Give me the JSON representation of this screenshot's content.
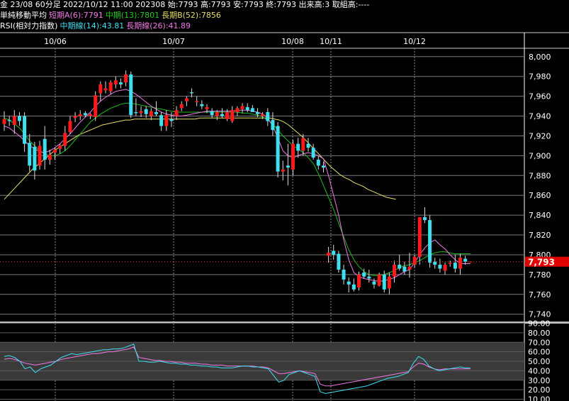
{
  "header": {
    "line1": "金 23/08 60分足 2022/10/12 11:00 202308 始:7793 高:7793 安:7793 終:7793 出来高:3 取組高:----",
    "ma_title": "単純移動平均",
    "ma_short": "短期A(6):7791",
    "ma_mid": "中期(13):7801",
    "ma_long": "長期B(52):7856",
    "rsi_title": "RSI(相対力指数)",
    "rsi_mid": "中期線(14):43.81",
    "rsi_long": "長期線(26):41.89"
  },
  "colors": {
    "background": "#000000",
    "up_candle": "#ff1a1a",
    "down_candle": "#3ee0f0",
    "ma_short": "#f27ae6",
    "ma_mid": "#22bb22",
    "ma_long": "#e6df6a",
    "rsi_mid": "#3ee0f0",
    "rsi_long": "#f27ae6",
    "price_tag": "#e00000"
  },
  "chart_data": [
    {
      "type": "candlestick",
      "x_labels": [
        "10/06",
        "10/07",
        "10/08",
        "10/11",
        "10/12"
      ],
      "ylim": [
        7734,
        8010
      ],
      "y_ticks": [
        7740,
        7760,
        7780,
        7800,
        7820,
        7840,
        7860,
        7880,
        7900,
        7920,
        7940,
        7960,
        7980,
        8000
      ],
      "y_tick_labels": [
        "7,740",
        "7,760",
        "7,780",
        "7,800",
        "7,820",
        "7,840",
        "7,860",
        "7,880",
        "7,900",
        "7,920",
        "7,940",
        "7,960",
        "7,980",
        "8,000"
      ],
      "last_price": 7793,
      "last_price_label": "7,793",
      "grid": true,
      "candles": [
        {
          "o": 7932,
          "h": 7945,
          "l": 7925,
          "c": 7937
        },
        {
          "o": 7936,
          "h": 7940,
          "l": 7930,
          "c": 7935
        },
        {
          "o": 7931,
          "h": 7946,
          "l": 7922,
          "c": 7940
        },
        {
          "o": 7940,
          "h": 7944,
          "l": 7930,
          "c": 7935
        },
        {
          "o": 7940,
          "h": 7944,
          "l": 7904,
          "c": 7912
        },
        {
          "o": 7913,
          "h": 7922,
          "l": 7884,
          "c": 7890
        },
        {
          "o": 7909,
          "h": 7914,
          "l": 7876,
          "c": 7885
        },
        {
          "o": 7890,
          "h": 7915,
          "l": 7886,
          "c": 7910
        },
        {
          "o": 7917,
          "h": 7930,
          "l": 7886,
          "c": 7896
        },
        {
          "o": 7896,
          "h": 7906,
          "l": 7891,
          "c": 7901
        },
        {
          "o": 7903,
          "h": 7908,
          "l": 7896,
          "c": 7906
        },
        {
          "o": 7907,
          "h": 7912,
          "l": 7902,
          "c": 7910
        },
        {
          "o": 7910,
          "h": 7930,
          "l": 7905,
          "c": 7923
        },
        {
          "o": 7924,
          "h": 7940,
          "l": 7922,
          "c": 7935
        },
        {
          "o": 7938,
          "h": 7944,
          "l": 7934,
          "c": 7940
        },
        {
          "o": 7940,
          "h": 7946,
          "l": 7936,
          "c": 7942
        },
        {
          "o": 7943,
          "h": 7945,
          "l": 7939,
          "c": 7941
        },
        {
          "o": 7940,
          "h": 7943,
          "l": 7937,
          "c": 7942
        },
        {
          "o": 7939,
          "h": 7965,
          "l": 7935,
          "c": 7961
        },
        {
          "o": 7963,
          "h": 7975,
          "l": 7955,
          "c": 7972
        },
        {
          "o": 7966,
          "h": 7975,
          "l": 7963,
          "c": 7968
        },
        {
          "o": 7965,
          "h": 7976,
          "l": 7962,
          "c": 7974
        },
        {
          "o": 7972,
          "h": 7980,
          "l": 7968,
          "c": 7976
        },
        {
          "o": 7974,
          "h": 7978,
          "l": 7968,
          "c": 7972
        },
        {
          "o": 7974,
          "h": 7986,
          "l": 7970,
          "c": 7982
        },
        {
          "o": 7982,
          "h": 7985,
          "l": 7938,
          "c": 7941
        },
        {
          "o": 7944,
          "h": 7958,
          "l": 7940,
          "c": 7943
        },
        {
          "o": 7943,
          "h": 7950,
          "l": 7939,
          "c": 7945
        },
        {
          "o": 7947,
          "h": 7950,
          "l": 7938,
          "c": 7942
        },
        {
          "o": 7940,
          "h": 7948,
          "l": 7936,
          "c": 7945
        },
        {
          "o": 7944,
          "h": 7955,
          "l": 7940,
          "c": 7942
        },
        {
          "o": 7941,
          "h": 7944,
          "l": 7925,
          "c": 7930
        },
        {
          "o": 7930,
          "h": 7946,
          "l": 7925,
          "c": 7941
        },
        {
          "o": 7937,
          "h": 7944,
          "l": 7929,
          "c": 7935
        },
        {
          "o": 7940,
          "h": 7950,
          "l": 7936,
          "c": 7946
        },
        {
          "o": 7948,
          "h": 7955,
          "l": 7945,
          "c": 7952
        },
        {
          "o": 7955,
          "h": 7960,
          "l": 7950,
          "c": 7958
        },
        {
          "o": 7964,
          "h": 7968,
          "l": 7959,
          "c": 7963
        },
        {
          "o": 7954,
          "h": 7960,
          "l": 7950,
          "c": 7955
        },
        {
          "o": 7952,
          "h": 7956,
          "l": 7947,
          "c": 7950
        },
        {
          "o": 7947,
          "h": 7952,
          "l": 7943,
          "c": 7949
        },
        {
          "o": 7945,
          "h": 7948,
          "l": 7938,
          "c": 7941
        },
        {
          "o": 7940,
          "h": 7946,
          "l": 7936,
          "c": 7944
        },
        {
          "o": 7942,
          "h": 7948,
          "l": 7938,
          "c": 7940
        },
        {
          "o": 7937,
          "h": 7947,
          "l": 7935,
          "c": 7944
        },
        {
          "o": 7935,
          "h": 7950,
          "l": 7933,
          "c": 7946
        },
        {
          "o": 7944,
          "h": 7950,
          "l": 7940,
          "c": 7948
        },
        {
          "o": 7947,
          "h": 7953,
          "l": 7943,
          "c": 7950
        },
        {
          "o": 7949,
          "h": 7953,
          "l": 7944,
          "c": 7946
        },
        {
          "o": 7948,
          "h": 7951,
          "l": 7945,
          "c": 7944
        },
        {
          "o": 7944,
          "h": 7948,
          "l": 7939,
          "c": 7942
        },
        {
          "o": 7940,
          "h": 7944,
          "l": 7937,
          "c": 7942
        },
        {
          "o": 7944,
          "h": 7948,
          "l": 7930,
          "c": 7935
        },
        {
          "o": 7936,
          "h": 7944,
          "l": 7920,
          "c": 7926
        },
        {
          "o": 7930,
          "h": 7934,
          "l": 7878,
          "c": 7884
        },
        {
          "o": 7884,
          "h": 7895,
          "l": 7875,
          "c": 7886
        },
        {
          "o": 7890,
          "h": 7912,
          "l": 7870,
          "c": 7888
        },
        {
          "o": 7886,
          "h": 7916,
          "l": 7880,
          "c": 7912
        },
        {
          "o": 7912,
          "h": 7918,
          "l": 7898,
          "c": 7905
        },
        {
          "o": 7905,
          "h": 7922,
          "l": 7900,
          "c": 7918
        },
        {
          "o": 7912,
          "h": 7918,
          "l": 7904,
          "c": 7908
        },
        {
          "o": 7908,
          "h": 7912,
          "l": 7896,
          "c": 7898
        },
        {
          "o": 7896,
          "h": 7900,
          "l": 7886,
          "c": 7890
        },
        {
          "o": 7890,
          "h": 7894,
          "l": 7883,
          "c": 7888
        },
        {
          "o": 7799,
          "h": 7808,
          "l": 7792,
          "c": 7802
        },
        {
          "o": 7804,
          "h": 7810,
          "l": 7795,
          "c": 7800
        },
        {
          "o": 7801,
          "h": 7804,
          "l": 7782,
          "c": 7785
        },
        {
          "o": 7785,
          "h": 7790,
          "l": 7770,
          "c": 7775
        },
        {
          "o": 7773,
          "h": 7777,
          "l": 7762,
          "c": 7770
        },
        {
          "o": 7770,
          "h": 7776,
          "l": 7763,
          "c": 7765
        },
        {
          "o": 7767,
          "h": 7783,
          "l": 7764,
          "c": 7780
        },
        {
          "o": 7782,
          "h": 7786,
          "l": 7776,
          "c": 7778
        },
        {
          "o": 7778,
          "h": 7785,
          "l": 7772,
          "c": 7776
        },
        {
          "o": 7773,
          "h": 7776,
          "l": 7766,
          "c": 7770
        },
        {
          "o": 7769,
          "h": 7782,
          "l": 7768,
          "c": 7780
        },
        {
          "o": 7780,
          "h": 7784,
          "l": 7762,
          "c": 7765
        },
        {
          "o": 7766,
          "h": 7782,
          "l": 7760,
          "c": 7778
        },
        {
          "o": 7778,
          "h": 7794,
          "l": 7772,
          "c": 7790
        },
        {
          "o": 7790,
          "h": 7800,
          "l": 7784,
          "c": 7786
        },
        {
          "o": 7788,
          "h": 7793,
          "l": 7780,
          "c": 7783
        },
        {
          "o": 7785,
          "h": 7802,
          "l": 7777,
          "c": 7788
        },
        {
          "o": 7790,
          "h": 7800,
          "l": 7787,
          "c": 7798
        },
        {
          "o": 7798,
          "h": 7838,
          "l": 7790,
          "c": 7838
        },
        {
          "o": 7838,
          "h": 7848,
          "l": 7832,
          "c": 7835
        },
        {
          "o": 7835,
          "h": 7840,
          "l": 7787,
          "c": 7792
        },
        {
          "o": 7793,
          "h": 7797,
          "l": 7786,
          "c": 7790
        },
        {
          "o": 7790,
          "h": 7796,
          "l": 7782,
          "c": 7786
        },
        {
          "o": 7784,
          "h": 7792,
          "l": 7780,
          "c": 7790
        },
        {
          "o": 7791,
          "h": 7794,
          "l": 7788,
          "c": 7792
        },
        {
          "o": 7792,
          "h": 7800,
          "l": 7782,
          "c": 7786
        },
        {
          "o": 7786,
          "h": 7801,
          "l": 7780,
          "c": 7797
        },
        {
          "o": 7796,
          "h": 7799,
          "l": 7790,
          "c": 7793
        },
        {
          "o": 7793,
          "h": 7793,
          "l": 7793,
          "c": 7793
        }
      ],
      "ma_short": [
        7930,
        7928,
        7924,
        7920,
        7915,
        7910,
        7907,
        7904,
        7903,
        7905,
        7908,
        7912,
        7917,
        7922,
        7928,
        7934,
        7939,
        7944,
        7950,
        7955,
        7959,
        7962,
        7965,
        7966,
        7967,
        7965,
        7962,
        7958,
        7954,
        7950,
        7947,
        7944,
        7942,
        7941,
        7940,
        7940,
        7941,
        7942,
        7943,
        7944,
        7945,
        7945,
        7945,
        7945,
        7945,
        7945,
        7946,
        7946,
        7946,
        7945,
        7944,
        7942,
        7938,
        7930,
        7918,
        7905,
        7900,
        7898,
        7900,
        7902,
        7903,
        7902,
        7900,
        7897,
        7880,
        7860,
        7840,
        7815,
        7795,
        7782,
        7778,
        7776,
        7775,
        7774,
        7773,
        7774,
        7775,
        7777,
        7780,
        7783,
        7785,
        7792,
        7800,
        7807,
        7812,
        7815,
        7810,
        7806,
        7800,
        7795,
        7791,
        7791,
        7791
      ],
      "ma_mid": [
        7938,
        7936,
        7932,
        7928,
        7922,
        7915,
        7910,
        7905,
        7902,
        7900,
        7900,
        7902,
        7905,
        7910,
        7916,
        7922,
        7928,
        7934,
        7938,
        7942,
        7945,
        7948,
        7950,
        7952,
        7953,
        7953,
        7952,
        7951,
        7950,
        7949,
        7948,
        7947,
        7946,
        7945,
        7944,
        7944,
        7944,
        7944,
        7944,
        7944,
        7944,
        7944,
        7944,
        7944,
        7944,
        7944,
        7944,
        7943,
        7943,
        7942,
        7941,
        7939,
        7936,
        7932,
        7926,
        7920,
        7915,
        7910,
        7907,
        7903,
        7898,
        7892,
        7882,
        7870,
        7858,
        7846,
        7832,
        7818,
        7805,
        7795,
        7788,
        7783,
        7780,
        7779,
        7779,
        7780,
        7782,
        7784,
        7787,
        7789,
        7790,
        7792,
        7794,
        7797,
        7800,
        7802,
        7803,
        7803,
        7802,
        7801,
        7801,
        7801,
        7801
      ],
      "ma_long": [
        7856,
        7861,
        7866,
        7871,
        7876,
        7881,
        7886,
        7890,
        7894,
        7898,
        7902,
        7906,
        7909,
        7912,
        7915,
        7918,
        7921,
        7923,
        7925,
        7927,
        7929,
        7931,
        7932,
        7933,
        7934,
        7935,
        7936,
        7936,
        7937,
        7937,
        7937,
        7937,
        7937,
        7937,
        7937,
        7937,
        7937,
        7937,
        7937,
        7937,
        7937,
        7937,
        7938,
        7938,
        7938,
        7938,
        7938,
        7938,
        7938,
        7938,
        7938,
        7938,
        7938,
        7938,
        7938,
        7938,
        7938,
        7938,
        7937,
        7936,
        7934,
        7931,
        7927,
        7923,
        7919,
        7914,
        7909,
        7904,
        7899,
        7894,
        7889,
        7885,
        7881,
        7878,
        7876,
        7873,
        7871,
        7869,
        7866,
        7864,
        7862,
        7860,
        7858,
        7857,
        7856
      ]
    },
    {
      "type": "line",
      "ylim": [
        10,
        90
      ],
      "y_ticks": [
        10,
        20,
        30,
        40,
        50,
        60,
        70,
        80,
        90
      ],
      "y_tick_labels": [
        "10.00",
        "20.00",
        "30.00",
        "40.00",
        "50.00",
        "60.00",
        "70.00",
        "80.00",
        "90.00"
      ],
      "bands": [
        [
          30,
          70
        ]
      ],
      "series": [
        {
          "name": "中期線(14)",
          "values": [
            55,
            56,
            54,
            50,
            42,
            44,
            38,
            42,
            44,
            46,
            50,
            54,
            56,
            58,
            57,
            58,
            59,
            60,
            61,
            62,
            62,
            63,
            63,
            64,
            66,
            68,
            50,
            50,
            49,
            49,
            50,
            49,
            48,
            48,
            47,
            47,
            46,
            46,
            45,
            45,
            44,
            44,
            43,
            43,
            43,
            44,
            45,
            45,
            44,
            44,
            43,
            42,
            35,
            28,
            30,
            36,
            38,
            40,
            38,
            36,
            34,
            18,
            16,
            17,
            18,
            19,
            20,
            21,
            22,
            23,
            24,
            26,
            28,
            30,
            32,
            33,
            34,
            36,
            38,
            48,
            55,
            52,
            45,
            42,
            40,
            41,
            42,
            43,
            44,
            43,
            43
          ]
        },
        {
          "name": "長期線(26)",
          "values": [
            52,
            53,
            52,
            50,
            48,
            47,
            46,
            47,
            48,
            49,
            50,
            52,
            53,
            54,
            55,
            56,
            57,
            58,
            58,
            59,
            60,
            60,
            61,
            62,
            63,
            65,
            54,
            53,
            52,
            51,
            51,
            50,
            50,
            49,
            49,
            48,
            48,
            48,
            47,
            47,
            46,
            46,
            46,
            45,
            45,
            45,
            45,
            45,
            45,
            44,
            44,
            43,
            40,
            37,
            37,
            38,
            39,
            40,
            39,
            38,
            37,
            26,
            24,
            24,
            25,
            26,
            27,
            28,
            29,
            30,
            31,
            32,
            33,
            34,
            35,
            36,
            37,
            38,
            39,
            44,
            48,
            47,
            44,
            42,
            41,
            42,
            42,
            42,
            42,
            42,
            42
          ]
        }
      ]
    }
  ]
}
